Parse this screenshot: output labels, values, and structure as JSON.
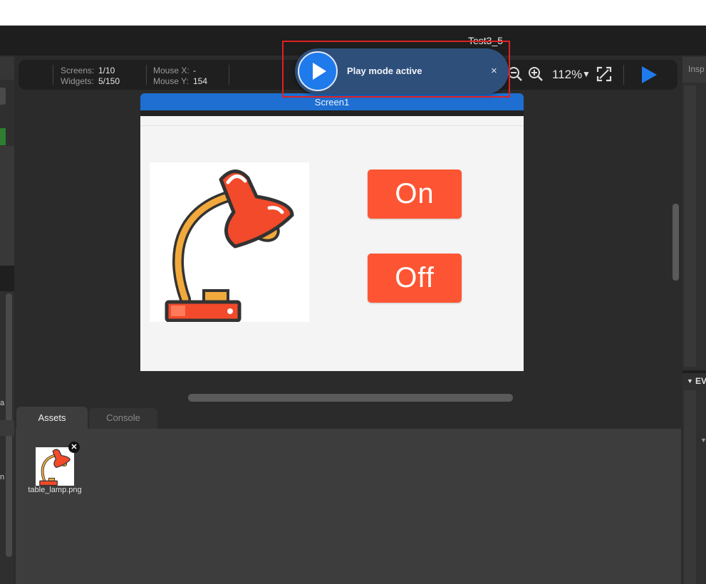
{
  "project": {
    "title": "Test3_5"
  },
  "toolbar": {
    "screens_label": "Screens:",
    "screens_value": "1/10",
    "widgets_label": "Widgets:",
    "widgets_value": "5/150",
    "mouse_x_label": "Mouse X:",
    "mouse_x_value": "-",
    "mouse_y_label": "Mouse Y:",
    "mouse_y_value": "154",
    "zoom": "112%",
    "icons": [
      "zoom-out-icon",
      "zoom-in-icon",
      "fit-screen-icon",
      "play-icon"
    ]
  },
  "notification": {
    "text": "Play mode active",
    "close": "×",
    "accent": "#1f7aec"
  },
  "screen": {
    "name": "Screen1",
    "buttons": {
      "on": "On",
      "off": "Off"
    },
    "button_color": "#fd5533",
    "image": "table-lamp"
  },
  "inspector": {
    "title": "Inspector",
    "title_visible": "Insp",
    "events_visible": "EV"
  },
  "bottom": {
    "tabs": {
      "assets": "Assets",
      "console": "Console"
    },
    "assets": [
      {
        "name": "table_lamp.png"
      }
    ]
  },
  "left_panel": {
    "label_a": "a",
    "label_n": "n"
  }
}
